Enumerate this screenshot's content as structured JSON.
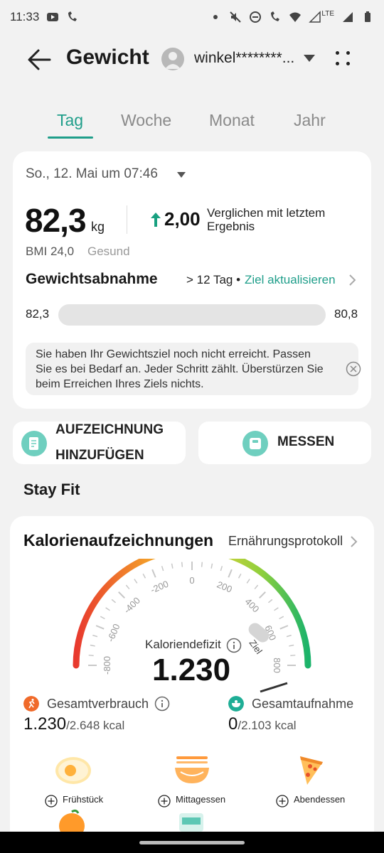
{
  "status_bar": {
    "time": "11:33",
    "network": "LTE"
  },
  "header": {
    "title": "Gewicht",
    "account": "winkel********..."
  },
  "tabs": [
    {
      "label": "Tag",
      "active": true
    },
    {
      "label": "Woche",
      "active": false
    },
    {
      "label": "Monat",
      "active": false
    },
    {
      "label": "Jahr",
      "active": false
    }
  ],
  "summary": {
    "date": "So., 12. Mai um 07:46",
    "weight": "82,3",
    "unit": "kg",
    "delta": "2,00",
    "delta_direction": "up",
    "compare_text": "Verglichen mit letztem Ergebnis",
    "bmi": "BMI 24,0",
    "bmi_status": "Gesund",
    "goal_label": "Gewichtsabnahme",
    "goal_days": "> 12 Tag •",
    "goal_link": "Ziel aktualisieren",
    "bar_start": "82,3",
    "bar_end": "80,8",
    "bar_progress": 0,
    "tip": "Sie haben Ihr Gewichtsziel noch nicht erreicht. Passen Sie es bei Bedarf an. Jeder Schritt zählt. Überstürzen Sie beim Erreichen Ihres Ziels nichts."
  },
  "actions": {
    "add_label": "AUFZEICHNUNG HINZUFÜGEN",
    "measure_label": "MESSEN"
  },
  "section_title": "Stay Fit",
  "calories": {
    "title": "Kalorienaufzeichnungen",
    "link": "Ernährungsprotokoll",
    "gauge_ticks": [
      "-800",
      "-600",
      "-400",
      "-200",
      "0",
      "200",
      "400",
      "600",
      "800"
    ],
    "goal_marker": "Ziel",
    "deficit_label": "Kaloriendefizit",
    "deficit_value": "1.230",
    "consumption_label": "Gesamtverbrauch",
    "consumption_value": "1.230",
    "consumption_total": "/2.648 kcal",
    "intake_label": "Gesamtaufnahme",
    "intake_value": "0",
    "intake_total": "/2.103 kcal",
    "meals": [
      {
        "label": "Frühstück",
        "icon": "egg-icon"
      },
      {
        "label": "Mittagessen",
        "icon": "noodle-bowl-icon"
      },
      {
        "label": "Abendessen",
        "icon": "pizza-icon"
      }
    ]
  },
  "colors": {
    "accent": "#1f9e8a",
    "up_arrow": "#18a080",
    "consumption_icon": "#f06a2a",
    "intake_icon": "#1fae96"
  }
}
